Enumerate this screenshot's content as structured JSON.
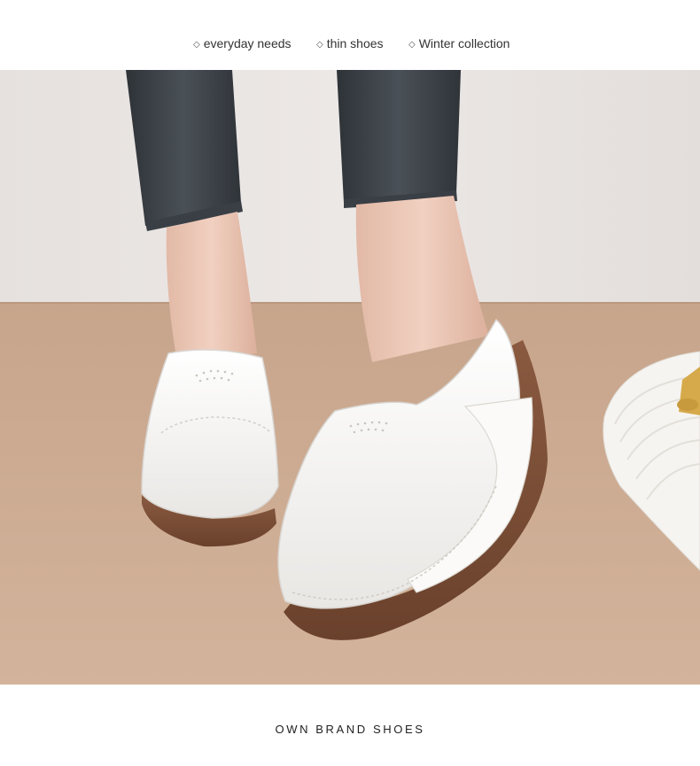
{
  "tags": [
    {
      "icon": "diamond-outline-icon",
      "label": "everyday needs"
    },
    {
      "icon": "diamond-outline-icon",
      "label": "thin shoes"
    },
    {
      "icon": "diamond-outline-icon",
      "label": "Winter collection"
    }
  ],
  "footer": {
    "brand_text": "OWN BRAND SHOES"
  },
  "colors": {
    "wall": "#e8e3e1",
    "floor": "#c9a88f",
    "jeans": "#3c4147",
    "shoe_white": "#f7f6f4",
    "sole_brown": "#7a4e36",
    "skin": "#ecc7b5"
  }
}
